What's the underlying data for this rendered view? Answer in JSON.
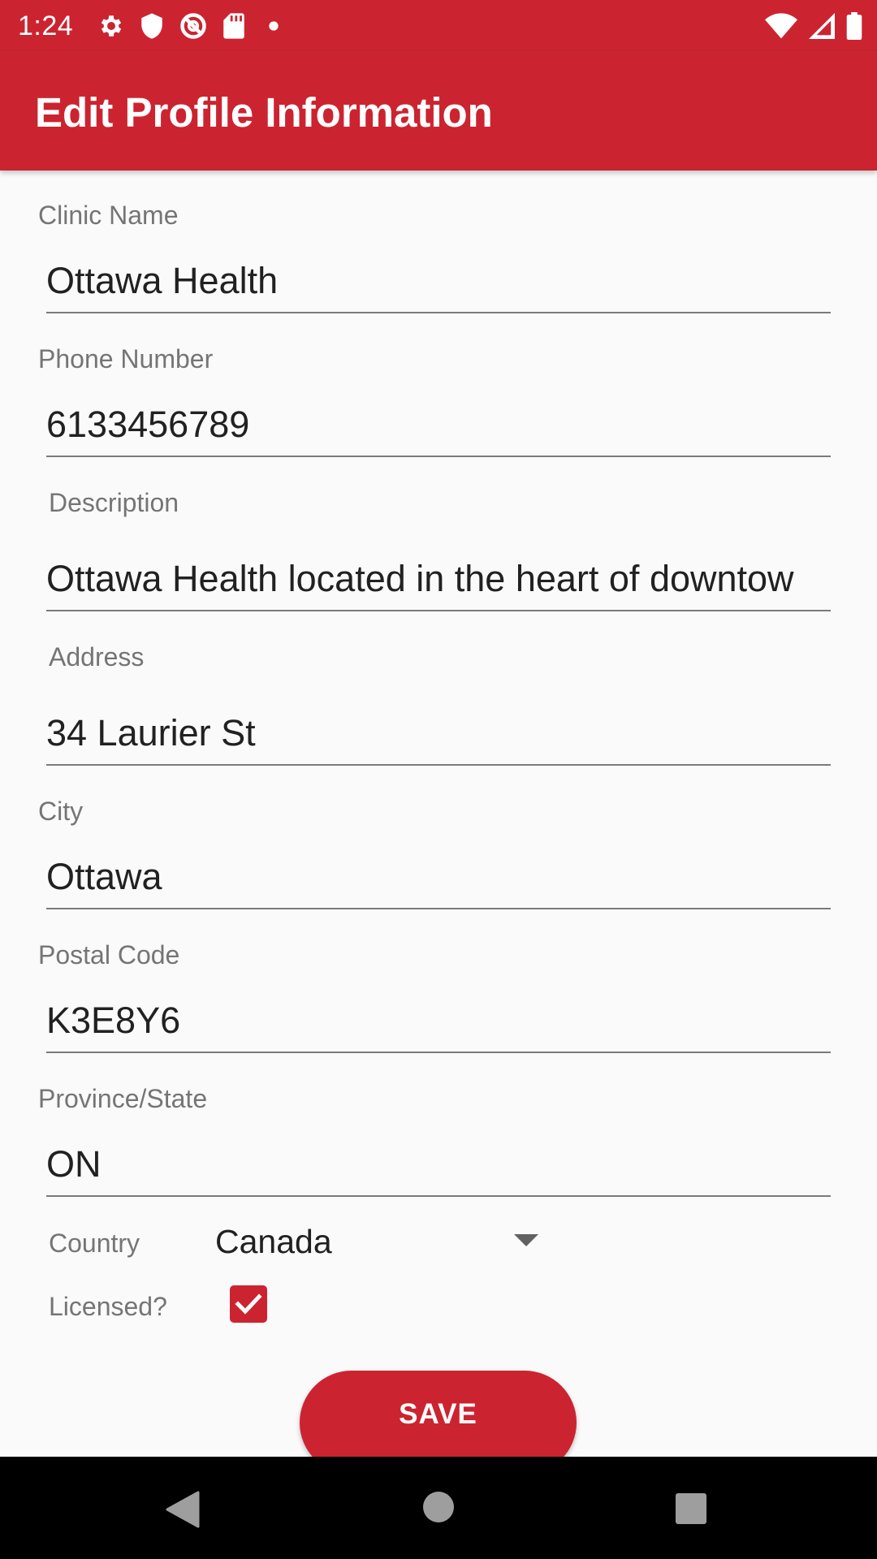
{
  "status_bar": {
    "time": "1:24",
    "icons_left": [
      "gear-icon",
      "shield-icon",
      "blocked-icon",
      "sd-card-icon",
      "dot-icon"
    ],
    "icons_right": [
      "wifi-icon",
      "cell-signal-icon",
      "battery-icon"
    ]
  },
  "app_bar": {
    "title": "Edit Profile Information"
  },
  "form": {
    "fields": [
      {
        "label": "Clinic Name",
        "value": "Ottawa Health"
      },
      {
        "label": "Phone Number",
        "value": "6133456789"
      },
      {
        "label": "Description",
        "value": "Ottawa Health located in the heart of downtow"
      },
      {
        "label": "Address",
        "value": "34 Laurier St"
      },
      {
        "label": "City",
        "value": "Ottawa"
      },
      {
        "label": "Postal Code",
        "value": "K3E8Y6"
      },
      {
        "label": "Province/State",
        "value": "ON"
      }
    ],
    "country": {
      "label": "Country",
      "selected": "Canada"
    },
    "licensed": {
      "label": "Licensed?",
      "checked": true
    },
    "save_label": "SAVE"
  },
  "nav_bar": {
    "icons": [
      "back-icon",
      "home-icon",
      "recents-icon"
    ]
  },
  "colors": {
    "primary": "#cb2430",
    "background": "#fafafa",
    "label": "#757575",
    "text": "#212121"
  }
}
